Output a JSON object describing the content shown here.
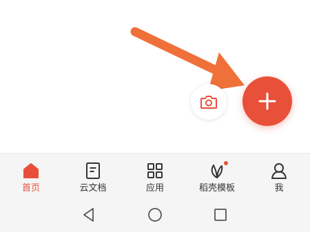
{
  "colors": {
    "accent": "#e8503a",
    "arrow": "#f0703a",
    "nav_background": "#f5f5f5",
    "icon_gray": "#333333"
  },
  "fab": {
    "icon": "plus-icon"
  },
  "camera_button": {
    "icon": "camera-icon"
  },
  "bottom_nav": {
    "active_index": 0,
    "items": [
      {
        "label": "首页",
        "icon": "home-icon"
      },
      {
        "label": "云文档",
        "icon": "document-icon"
      },
      {
        "label": "应用",
        "icon": "apps-grid-icon"
      },
      {
        "label": "稻壳模板",
        "icon": "leaf-icon",
        "badge": "dot"
      },
      {
        "label": "我",
        "icon": "person-icon"
      }
    ]
  },
  "system_nav": {
    "buttons": [
      "back-triangle-icon",
      "home-circle-icon",
      "recents-square-icon"
    ]
  }
}
